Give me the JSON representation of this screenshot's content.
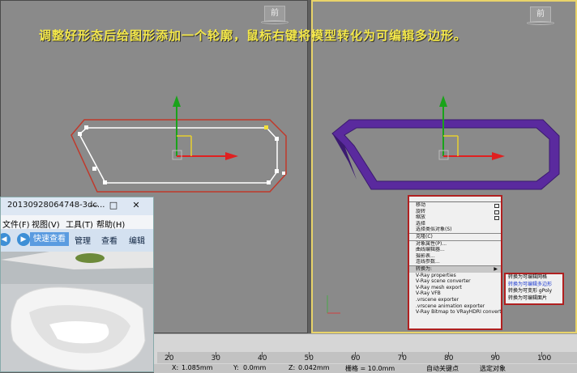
{
  "caption": "调整好形态后给图形添加一个轮廓，鼠标右键将模型转化为可编辑多边形。",
  "viewport": {
    "left_cube_label": "前",
    "right_cube_label": "前"
  },
  "context_menu": {
    "items": [
      {
        "label": "移动",
        "box": true
      },
      {
        "label": "旋转",
        "box": true
      },
      {
        "label": "缩放",
        "box": true
      },
      {
        "label": "选择"
      },
      {
        "label": "选择类似对象(S)"
      },
      {
        "label": "克隆(C)",
        "sep": true
      },
      {
        "label": "对象属性(P)...",
        "sep": true
      },
      {
        "label": "曲线编辑器..."
      },
      {
        "label": "摄影表..."
      },
      {
        "label": "连线参数..."
      },
      {
        "label": "转换为:",
        "sep": true,
        "arrow": true,
        "highlight": true
      },
      {
        "label": "V-Ray properties"
      },
      {
        "label": "V-Ray scene converter"
      },
      {
        "label": "V-Ray mesh export"
      },
      {
        "label": "V-Ray VFB"
      },
      {
        "label": ".vrscene exporter"
      },
      {
        "label": ".vrscene animation exporter"
      },
      {
        "label": "V-Ray Bitmap to VRayHDRI converter"
      }
    ],
    "submenu": [
      {
        "label": "转换为可编辑网格",
        "active": false
      },
      {
        "label": "转换为可编辑多边形",
        "active": true
      },
      {
        "label": "转换为可变形 gPoly",
        "active": false
      },
      {
        "label": "转换为可编辑面片",
        "active": false
      }
    ]
  },
  "explorer": {
    "title": "20130928064748-3dc...",
    "minimize": "—",
    "maximize": "□",
    "close": "✕",
    "menu": [
      "文件(F)",
      "视图(V)",
      "工具(T)",
      "帮助(H)"
    ],
    "nav_back": "◀",
    "nav_forward": "▶",
    "toolbar": [
      "快速查看",
      "管理",
      "查看",
      "编辑"
    ]
  },
  "timeline": {
    "ticks": [
      "20",
      "30",
      "40",
      "50",
      "60",
      "70",
      "80",
      "90",
      "100"
    ]
  },
  "status": {
    "x_label": "X:",
    "x_value": "1.085mm",
    "y_label": "Y:",
    "y_value": "0.0mm",
    "z_label": "Z:",
    "z_value": "0.042mm",
    "grid": "栅格 = 10.0mm",
    "autokey": "自动关键点",
    "selection": "选定对象"
  },
  "colors": {
    "caption": "#f4e84a",
    "shape_outline": "#c0392b",
    "shape_fill": "#5a2a9e",
    "viewport_bg": "#8a8a8a",
    "active_border": "#e8d36a",
    "submenu_active": "#1c3ad0"
  }
}
